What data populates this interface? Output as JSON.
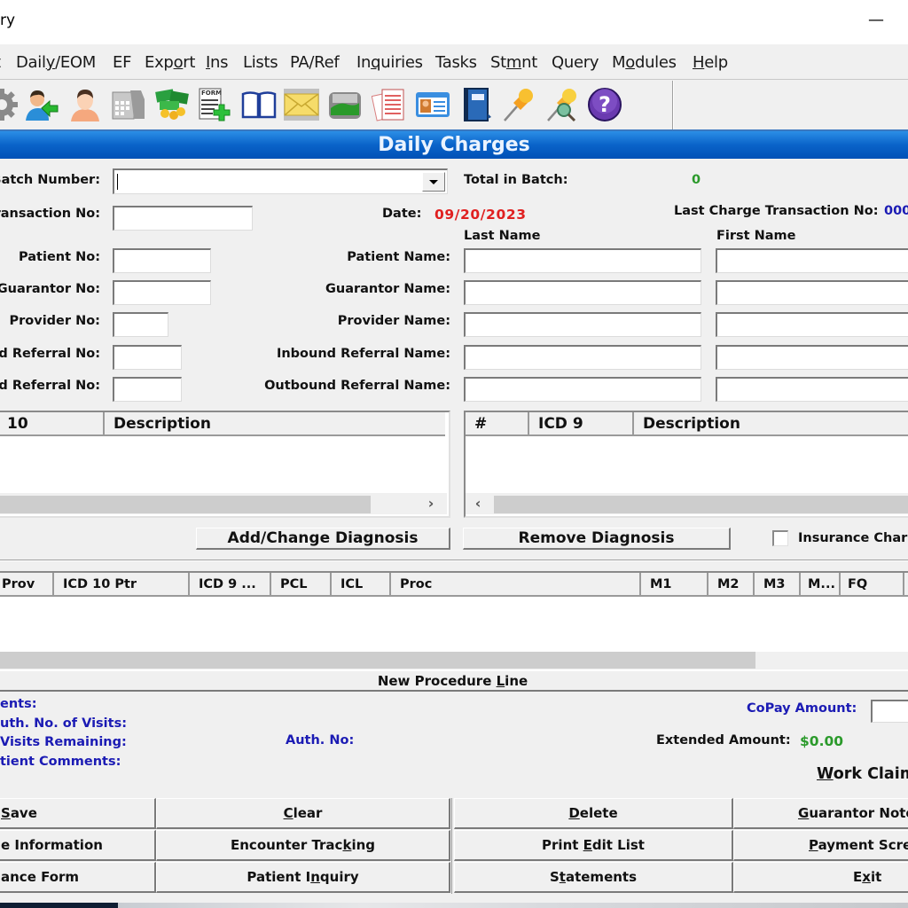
{
  "window": {
    "title_fragment": "ry",
    "minimize_glyph": "—"
  },
  "menu": [
    {
      "label": "t",
      "underline": ""
    },
    {
      "label": "Daily/EOM",
      "pre": "Dail",
      "u": "y",
      "post": "/EOM"
    },
    {
      "label": "EF"
    },
    {
      "label": "Export",
      "pre": "Exp",
      "u": "o",
      "post": "rt"
    },
    {
      "label": "Ins",
      "pre": "",
      "u": "I",
      "post": "ns"
    },
    {
      "label": "Lists"
    },
    {
      "label": "PA/Ref"
    },
    {
      "label": "Inquiries",
      "pre": "In",
      "u": "q",
      "post": "uiries"
    },
    {
      "label": "Tasks"
    },
    {
      "label": "Stmnt",
      "pre": "St",
      "u": "m",
      "post": "nt"
    },
    {
      "label": "Query"
    },
    {
      "label": "Modules",
      "pre": "M",
      "u": "o",
      "post": "dules"
    },
    {
      "label": "Help",
      "pre": "",
      "u": "H",
      "post": "elp"
    }
  ],
  "toolbar": [
    {
      "icon": "gear-icon"
    },
    {
      "icon": "patient-transfer-icon"
    },
    {
      "icon": "patient-icon"
    },
    {
      "icon": "calculator-payment-icon"
    },
    {
      "icon": "money-icon"
    },
    {
      "icon": "new-form-icon",
      "text": "FORM"
    },
    {
      "icon": "book-icon"
    },
    {
      "icon": "envelope-icon"
    },
    {
      "icon": "scanner-icon"
    },
    {
      "icon": "documents-icon"
    },
    {
      "icon": "id-card-icon"
    },
    {
      "icon": "notebook-icon"
    },
    {
      "icon": "pushpin-icon"
    },
    {
      "icon": "pushpin-search-icon"
    },
    {
      "icon": "help-icon",
      "text": "?"
    }
  ],
  "header": {
    "title": "Daily Charges"
  },
  "form": {
    "batch_number_label": "Batch Number:",
    "batch_number_value": "",
    "total_in_batch_label": "Total in Batch:",
    "total_in_batch_value": "0",
    "transaction_no_label": "ransaction No:",
    "transaction_no_value": "",
    "date_label": "Date:",
    "date_value": "09/20/2023",
    "last_charge_label": "Last Charge Transaction No:",
    "last_charge_value": "000",
    "last_name_header": "Last Name",
    "first_name_header": "First Name",
    "rows": [
      {
        "no_label": "Patient No:",
        "name_label": "Patient Name:"
      },
      {
        "no_label": "Guarantor No:",
        "name_label": "Guarantor Name:"
      },
      {
        "no_label": "Provider No:",
        "name_label": "Provider Name:"
      },
      {
        "no_label": "d Referral No:",
        "name_label": "Inbound Referral Name:"
      },
      {
        "no_label": "d Referral No:",
        "name_label": "Outbound Referral Name:"
      }
    ]
  },
  "diagnosis": {
    "icd10_grid": {
      "columns": [
        "10",
        "Description"
      ]
    },
    "icd9_grid": {
      "columns": [
        "#",
        "ICD 9",
        "Description"
      ]
    },
    "add_change_button": "Add/Change Diagnosis",
    "remove_button": "Remove Diagnosis",
    "insurance_checkbox_label": "Insurance Char",
    "insurance_checked": false
  },
  "procedures": {
    "columns": [
      "Prov",
      "ICD 10 Ptr",
      "ICD 9 ...",
      "PCL",
      "ICL",
      "Proc",
      "M1",
      "M2",
      "M3",
      "M...",
      "FQ"
    ],
    "new_line_button": {
      "pre": "New Procedure ",
      "u": "L",
      "post": "ine"
    }
  },
  "info": {
    "comments_label": "ents:",
    "auth_visits_label": "uth. No. of Visits:",
    "visits_remaining_label": "Visits Remaining:",
    "patient_comments_label": "tient Comments:",
    "auth_no_label": "Auth. No:",
    "copay_label": "CoPay Amount:",
    "copay_value": "",
    "extended_label": "Extended Amount:",
    "extended_value": "$0.00",
    "work_claim": {
      "u": "W",
      "post": "ork Claim"
    }
  },
  "buttons": [
    [
      {
        "pre": "",
        "u": "S",
        "post": "ave"
      },
      {
        "pre": "",
        "u": "C",
        "post": "lear"
      },
      {
        "pre": "",
        "u": "D",
        "post": "elete"
      },
      {
        "pre": "",
        "u": "G",
        "post": "uarantor Note"
      }
    ],
    [
      {
        "pre": "e Information",
        "u": "",
        "post": ""
      },
      {
        "pre": "Encounter Trac",
        "u": "k",
        "post": "ing"
      },
      {
        "pre": "Print ",
        "u": "E",
        "post": "dit List"
      },
      {
        "pre": "",
        "u": "P",
        "post": "ayment Scre"
      }
    ],
    [
      {
        "pre": "ance Form",
        "u": "",
        "post": ""
      },
      {
        "pre": "Patient I",
        "u": "n",
        "post": "quiry"
      },
      {
        "pre": "S",
        "u": "t",
        "post": "atements"
      },
      {
        "pre": "E",
        "u": "x",
        "post": "it"
      }
    ]
  ],
  "colors": {
    "header_blue": "#0a63c9",
    "date_red": "#e02020",
    "total_green": "#2b9a2b",
    "label_blue": "#1b1bb4"
  }
}
